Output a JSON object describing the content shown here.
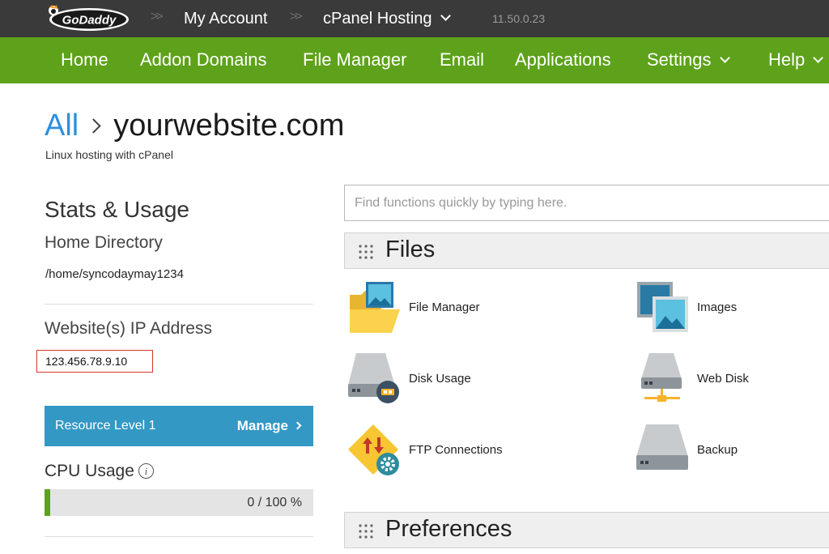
{
  "topbar": {
    "logo_text": "GoDaddy",
    "my_account": "My Account",
    "product": "cPanel Hosting",
    "version": "11.50.0.23"
  },
  "nav": {
    "home": "Home",
    "addon_domains": "Addon Domains",
    "file_manager": "File Manager",
    "email": "Email",
    "applications": "Applications",
    "settings": "Settings",
    "help": "Help"
  },
  "header": {
    "all": "All",
    "site": "yourwebsite.com",
    "subtitle": "Linux hosting with cPanel"
  },
  "stats": {
    "title": "Stats & Usage",
    "home_dir_label": "Home Directory",
    "home_dir_value": "/home/syncodaymay1234",
    "ip_label": "Website(s) IP Address",
    "ip_value": "123.456.78.9.10",
    "resource_label": "Resource Level 1",
    "manage": "Manage",
    "cpu_label": "CPU Usage",
    "cpu_used": 0,
    "cpu_max": 100,
    "cpu_text": "0 / 100 %"
  },
  "search": {
    "placeholder": "Find functions quickly by typing here."
  },
  "sections": {
    "files": "Files",
    "preferences": "Preferences"
  },
  "files_tools": {
    "file_manager": "File Manager",
    "images": "Images",
    "disk_usage": "Disk Usage",
    "web_disk": "Web Disk",
    "ftp_connections": "FTP Connections",
    "backup": "Backup"
  },
  "colors": {
    "topbar": "#3a3a3a",
    "navbar": "#5da21a",
    "link": "#2f8fdc",
    "resource": "#3498c4",
    "highlight_border": "#d9372a"
  }
}
